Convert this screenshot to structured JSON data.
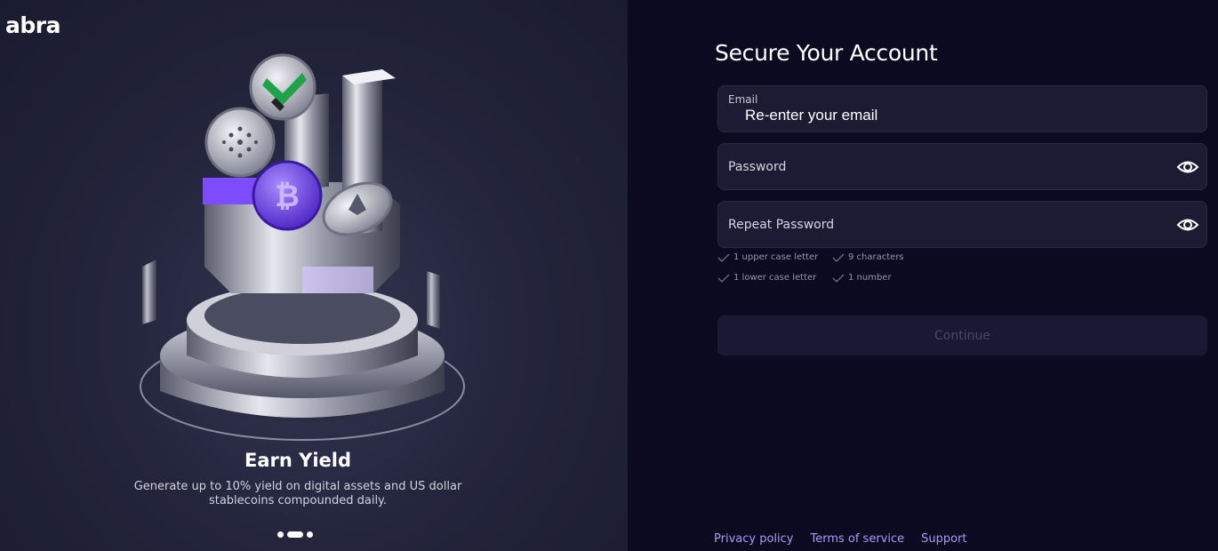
{
  "brand": {
    "logo_text": "abra"
  },
  "slide": {
    "title": "Earn Yield",
    "description": "Generate up to 10% yield on digital assets and US dollar stablecoins compounded daily.",
    "active_index": 1,
    "total": 3
  },
  "form": {
    "title": "Secure Your Account",
    "email": {
      "label": "Email",
      "value": "Re-enter your email"
    },
    "password": {
      "placeholder": "Password"
    },
    "repeat_password": {
      "placeholder": "Repeat Password"
    },
    "rules": {
      "upper": "1 upper case letter",
      "chars": "9 characters",
      "lower": "1 lower case letter",
      "number": "1 number"
    },
    "continue_label": "Continue"
  },
  "footer": {
    "privacy": "Privacy policy",
    "terms": "Terms of service",
    "support": "Support"
  },
  "colors": {
    "accent": "#a79cf3",
    "panel_bg": "#0c0a20",
    "field_bg": "#1d1b33",
    "button_disabled_bg": "#1a1833"
  }
}
